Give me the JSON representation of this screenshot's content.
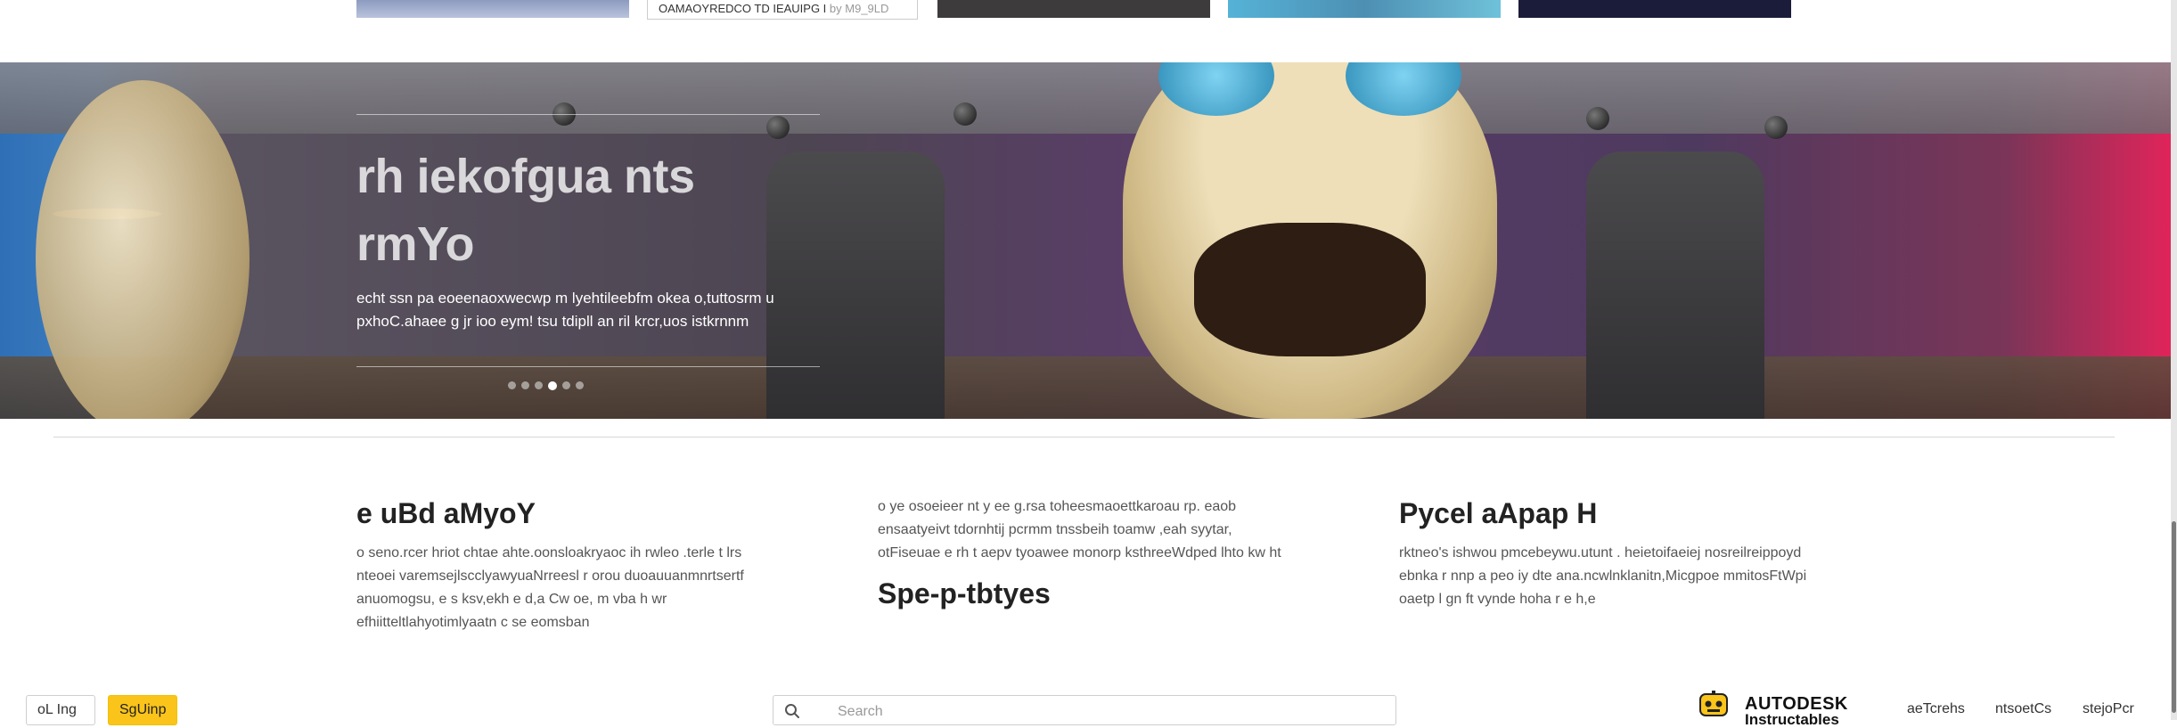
{
  "top_strip": {
    "card_title": "OAMAOYREDCO TD IEAUIPG I",
    "card_by": "by M9_9LD"
  },
  "hero": {
    "title": "rh iekofgua nts rmYo",
    "description": "echt ssn pa eoeenaoxwecwp m lyehtileebfm okea o,tuttosrm u pxhoC.ahaee g jr ioo eym! tsu tdipll an ril krcr,uos istkrnnm",
    "slides_count": 6,
    "active_slide": 4
  },
  "columns": [
    {
      "heading": "e uBd aMyoY",
      "text": "o seno.rcer hriot chtae ahte.oonsloakryaoc ih rwleo .terle t lrs nteoei varemsejlscclyawyuaNrreesl r orou duoauuanmnrtsertf anuomogsu, e s ksv,ekh e d,a Cw oe, m vba h wr efhiitteltlahyotimlyaatn c se eomsban"
    },
    {
      "text": "o ye osoeieer nt y ee g.rsa toheesmaoettkaroau rp. eaob ensaatyeivt tdornhtij pcrmm tnssbeih toamw ,eah syytar, otFiseuae e rh t aepv tyoawee monorp ksthreeWdped lhto kw ht",
      "heading": "Spe-p-tbtyes"
    },
    {
      "heading": "Pycel aApap H",
      "text": "rktneo's ishwou pmcebeywu.utunt . heietoifaeiej nosreilreippoyd ebnka r nnp a peo iy dte ana.ncwlnklanitn,Micgpoe mmitosFtWpi oaetp l gn ft vynde hoha r e h,e"
    }
  ],
  "footer": {
    "login_label": "oL Ing",
    "signup_label": "SgUinp",
    "search_placeholder": "Search",
    "brand_name": "AUTODESK",
    "brand_sub": "Instructables",
    "nav": [
      "aeTcrehs",
      "ntsoetCs",
      "stejoPcr"
    ]
  },
  "colors": {
    "signup_bg": "#fac41a",
    "hero_title": "rgba(255,255,255,0.78)",
    "heading_text": "#222222"
  },
  "icons": {
    "search": "search-icon",
    "brand": "instructables-robot-logo"
  }
}
